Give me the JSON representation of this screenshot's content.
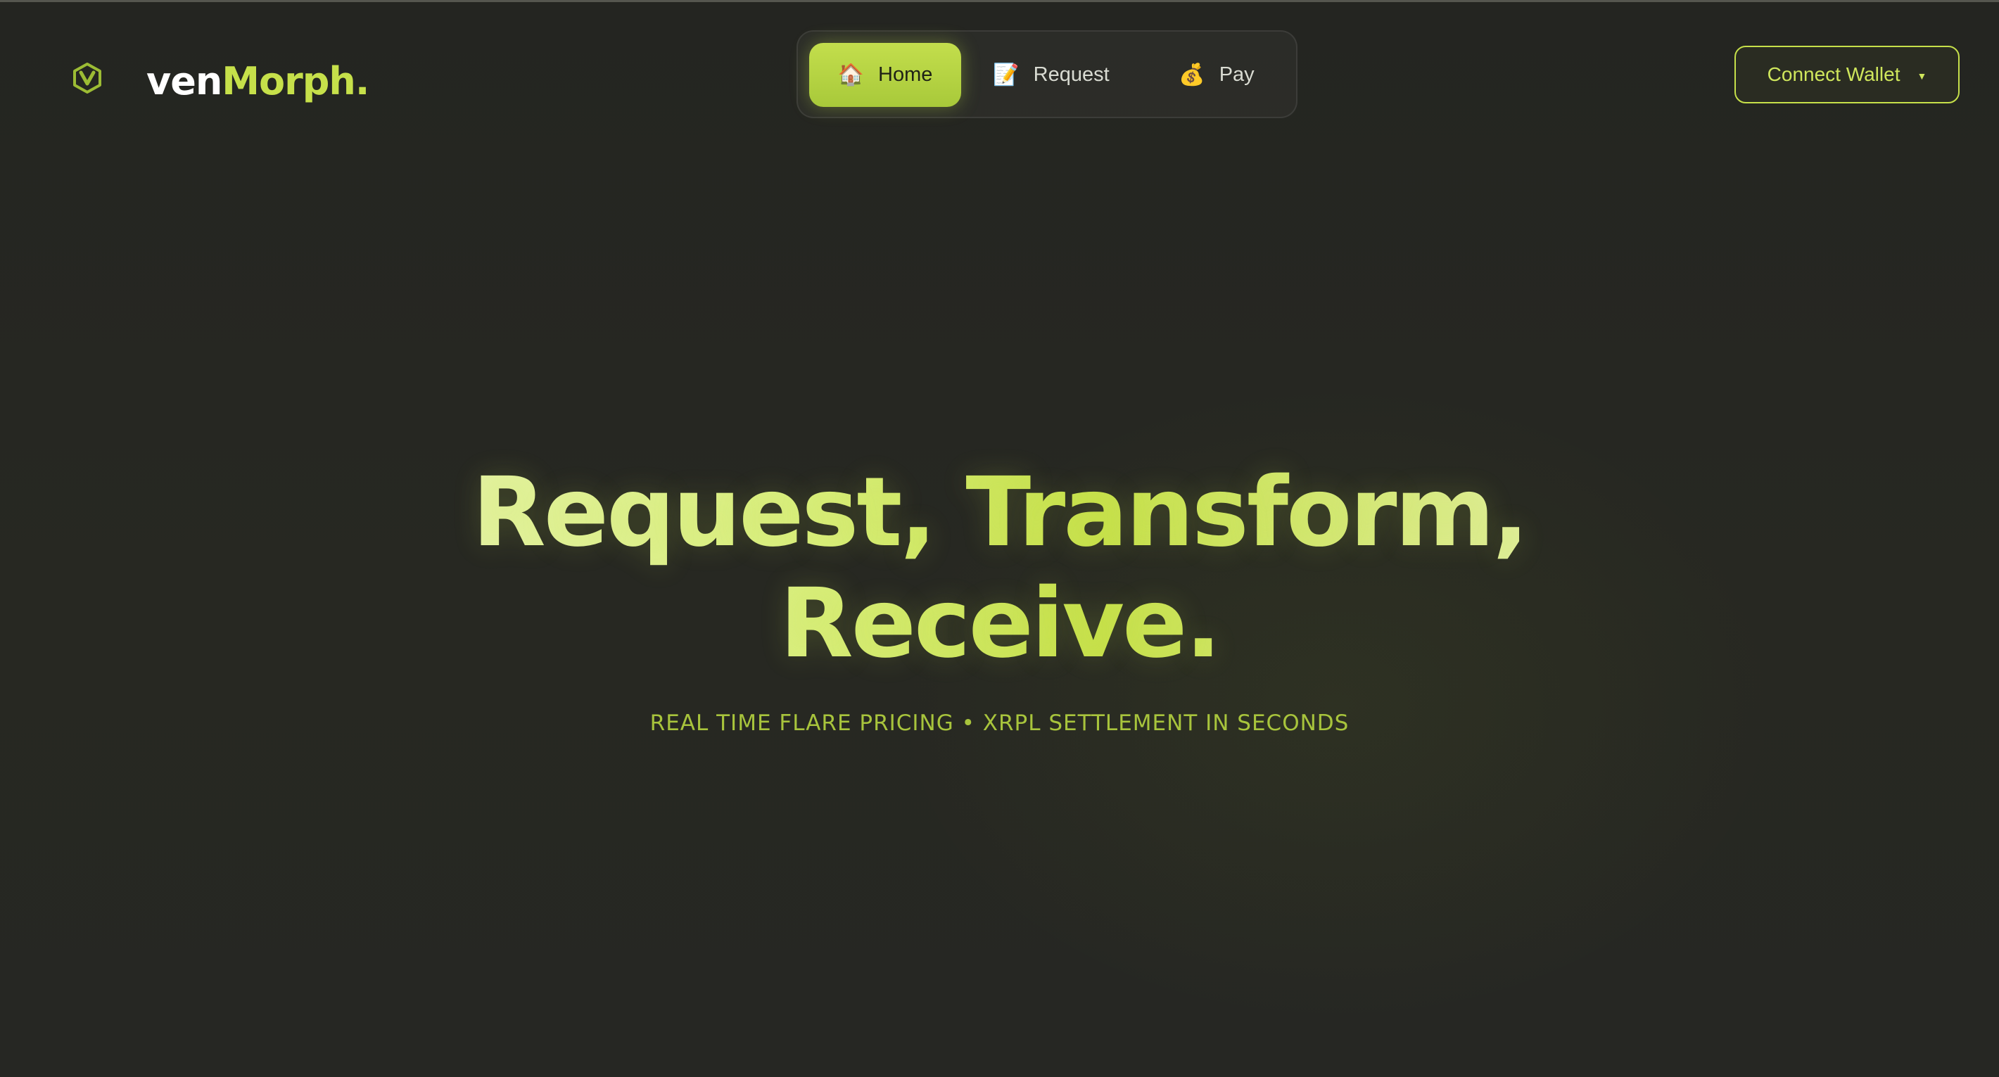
{
  "brand": {
    "prefix": "ven",
    "highlight": "Morph",
    "suffix": ".",
    "logo_icon": "hexagon-v-logo-icon"
  },
  "nav": {
    "items": [
      {
        "label": "Home",
        "icon": "house-icon",
        "emoji": "🏠",
        "active": true
      },
      {
        "label": "Request",
        "icon": "document-icon",
        "emoji": "📝",
        "active": false
      },
      {
        "label": "Pay",
        "icon": "money-bag-icon",
        "emoji": "💰",
        "active": false
      }
    ]
  },
  "wallet": {
    "label": "Connect Wallet",
    "caret": "▼",
    "caret_icon": "chevron-down-icon"
  },
  "hero": {
    "headline_line1": "Request, Transform,",
    "headline_line2": "Receive.",
    "subline": "REAL TIME FLARE PRICING • XRPL SETTLEMENT IN SECONDS"
  },
  "colors": {
    "background": "#262722",
    "accent": "#c6e04a",
    "accent_dim": "#a8c43c",
    "text_light": "#ffffff"
  }
}
